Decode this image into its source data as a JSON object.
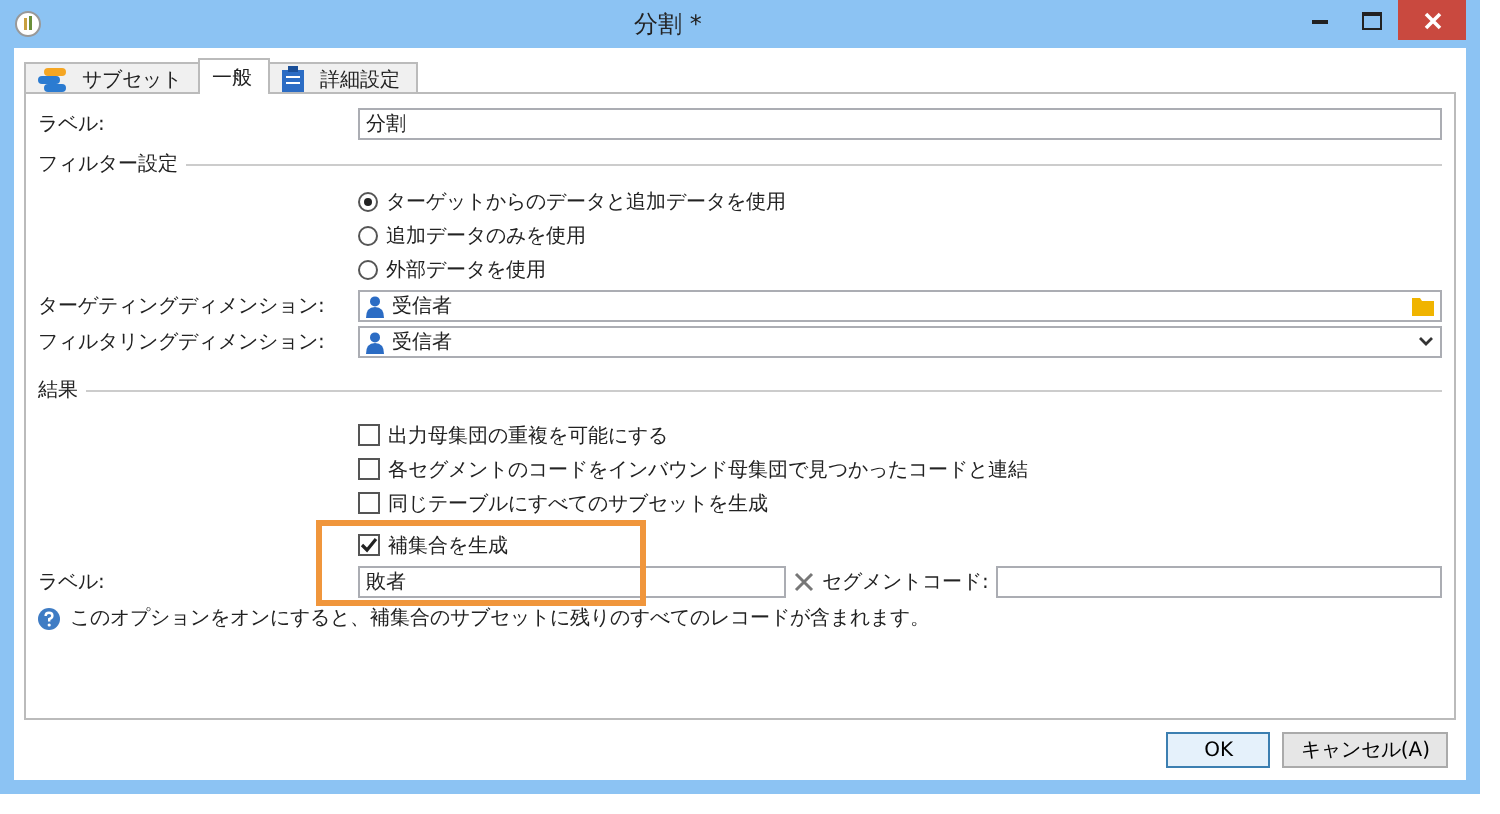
{
  "window": {
    "title": "分割 *"
  },
  "tabs": [
    {
      "label": "サブセット",
      "selected": false,
      "kind": "stack"
    },
    {
      "label": "一般",
      "selected": true,
      "kind": "plain"
    },
    {
      "label": "詳細設定",
      "selected": false,
      "kind": "clipboard"
    }
  ],
  "label_field": {
    "label": "ラベル:",
    "value": "分割"
  },
  "filter": {
    "heading": "フィルター設定",
    "options": [
      {
        "label": "ターゲットからのデータと追加データを使用",
        "selected": true
      },
      {
        "label": "追加データのみを使用",
        "selected": false
      },
      {
        "label": "外部データを使用",
        "selected": false
      }
    ]
  },
  "targeting": {
    "label": "ターゲティングディメンション:",
    "value": "受信者"
  },
  "filtering": {
    "label": "フィルタリングディメンション:",
    "value": "受信者"
  },
  "result": {
    "heading": "結果",
    "options": [
      {
        "label": "出力母集団の重複を可能にする",
        "checked": false,
        "highlighted": false
      },
      {
        "label": "各セグメントのコードをインバウンド母集団で見つかったコードと連結",
        "checked": false,
        "highlighted": false
      },
      {
        "label": "同じテーブルにすべてのサブセットを生成",
        "checked": false,
        "highlighted": false
      },
      {
        "label": "補集合を生成",
        "checked": true,
        "highlighted": true
      }
    ]
  },
  "complement": {
    "label": "ラベル:",
    "value": "敗者",
    "code_label": "セグメントコード:"
  },
  "info": "このオプションをオンにすると、補集合のサブセットに残りのすべてのレコードが含まれます。",
  "buttons": [
    {
      "label": "OK",
      "default": true
    },
    {
      "label": "キャンセル(A)",
      "default": false
    }
  ]
}
